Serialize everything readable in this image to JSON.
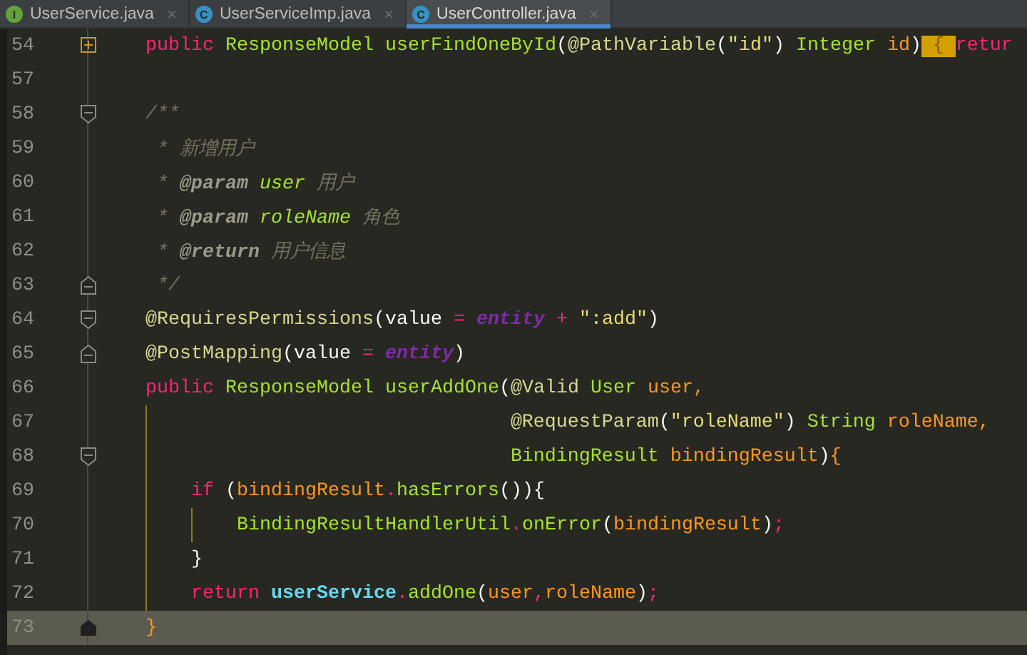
{
  "tabs": [
    {
      "icon": {
        "letter": "I",
        "color": "#62a33a"
      },
      "label": "UserService.java",
      "close": "×",
      "selected": false
    },
    {
      "icon": {
        "letter": "C",
        "color": "#3592c4"
      },
      "label": "UserServiceImp.java",
      "close": "×",
      "selected": false
    },
    {
      "icon": {
        "letter": "C",
        "color": "#3592c4"
      },
      "label": "UserController.java",
      "close": "×",
      "selected": true
    }
  ],
  "editor": {
    "lines": [
      {
        "number": "54",
        "fold": {
          "kind": "collapsed"
        },
        "kind": "top",
        "current": false,
        "tokens": [
          {
            "text": "public ",
            "kind": "keyword"
          },
          {
            "text": "ResponseModel ",
            "kind": "type"
          },
          {
            "text": "userFindOneById",
            "kind": "type"
          },
          {
            "text": "(",
            "kind": "plain"
          },
          {
            "text": "@PathVariable",
            "kind": "annotation"
          },
          {
            "text": "(",
            "kind": "plain"
          },
          {
            "text": "\"id\"",
            "kind": "string"
          },
          {
            "text": ") ",
            "kind": "plain"
          },
          {
            "text": "Integer ",
            "kind": "type"
          },
          {
            "text": "id",
            "kind": "param"
          },
          {
            "text": ")",
            "kind": "plain"
          },
          {
            "text": "{",
            "kind": "fold-box"
          },
          {
            "text": "retur",
            "kind": "keyword"
          }
        ]
      },
      {
        "number": "57",
        "kind": "top",
        "current": false
      },
      {
        "number": "58",
        "fold": {
          "kind": "start"
        },
        "kind": "top",
        "current": false,
        "tokens": [
          {
            "text": "/**",
            "kind": "comment"
          }
        ]
      },
      {
        "number": "59",
        "kind": "doc",
        "current": false,
        "tokens": [
          {
            "text": "* 新增用户",
            "kind": "comment"
          }
        ]
      },
      {
        "number": "60",
        "kind": "doc",
        "current": false,
        "tokens": [
          {
            "text": "* ",
            "kind": "comment"
          },
          {
            "text": "@param ",
            "kind": "doctag"
          },
          {
            "text": "user",
            "kind": "docparam"
          },
          {
            "text": " 用户",
            "kind": "comment"
          }
        ]
      },
      {
        "number": "61",
        "kind": "doc",
        "current": false,
        "tokens": [
          {
            "text": "* ",
            "kind": "comment"
          },
          {
            "text": "@param ",
            "kind": "doctag"
          },
          {
            "text": "roleName",
            "kind": "docparam"
          },
          {
            "text": " 角色",
            "kind": "comment"
          }
        ]
      },
      {
        "number": "62",
        "kind": "doc",
        "current": false,
        "tokens": [
          {
            "text": "* ",
            "kind": "comment"
          },
          {
            "text": "@return",
            "kind": "doctag"
          },
          {
            "text": " 用户信息",
            "kind": "comment"
          }
        ]
      },
      {
        "number": "63",
        "fold": {
          "kind": "end"
        },
        "kind": "doc",
        "current": false,
        "tokens": [
          {
            "text": "*/",
            "kind": "comment"
          }
        ]
      },
      {
        "number": "64",
        "fold": {
          "kind": "start"
        },
        "kind": "top",
        "current": false,
        "tokens": [
          {
            "text": "@RequiresPermissions",
            "kind": "annotation"
          },
          {
            "text": "(value ",
            "kind": "plain"
          },
          {
            "text": "= ",
            "kind": "operator"
          },
          {
            "text": "entity ",
            "kind": "constant"
          },
          {
            "text": "+ ",
            "kind": "operator"
          },
          {
            "text": "\":add\"",
            "kind": "string"
          },
          {
            "text": ")",
            "kind": "plain"
          }
        ]
      },
      {
        "number": "65",
        "fold": {
          "kind": "end"
        },
        "kind": "top",
        "current": false,
        "tokens": [
          {
            "text": "@PostMapping",
            "kind": "annotation"
          },
          {
            "text": "(value ",
            "kind": "plain"
          },
          {
            "text": "= ",
            "kind": "operator"
          },
          {
            "text": "entity",
            "kind": "constant"
          },
          {
            "text": ")",
            "kind": "plain"
          }
        ]
      },
      {
        "number": "66",
        "kind": "top",
        "current": false,
        "tokens": [
          {
            "text": "public ",
            "kind": "keyword"
          },
          {
            "text": "ResponseModel ",
            "kind": "type"
          },
          {
            "text": "userAddOne",
            "kind": "type"
          },
          {
            "text": "(",
            "kind": "plain"
          },
          {
            "text": "@Valid ",
            "kind": "annotation"
          },
          {
            "text": "User ",
            "kind": "type"
          },
          {
            "text": "user,",
            "kind": "param"
          }
        ]
      },
      {
        "number": "67",
        "kind": "continuation",
        "current": false,
        "tokens": [
          {
            "text": "@RequestParam",
            "kind": "annotation"
          },
          {
            "text": "(",
            "kind": "plain"
          },
          {
            "text": "\"roleName\"",
            "kind": "string"
          },
          {
            "text": ") ",
            "kind": "plain"
          },
          {
            "text": "String ",
            "kind": "type"
          },
          {
            "text": "roleName,",
            "kind": "param"
          }
        ]
      },
      {
        "number": "68",
        "fold": {
          "kind": "start"
        },
        "kind": "continuation",
        "current": false,
        "tokens": [
          {
            "text": "BindingResult ",
            "kind": "type"
          },
          {
            "text": "bindingResult",
            "kind": "param"
          },
          {
            "text": ")",
            "kind": "plain"
          },
          {
            "text": "{",
            "kind": "param"
          }
        ]
      },
      {
        "number": "69",
        "kind": "block",
        "current": false,
        "tokens": [
          {
            "text": "if ",
            "kind": "keyword"
          },
          {
            "text": "(",
            "kind": "plain"
          },
          {
            "text": "bindingResult",
            "kind": "param"
          },
          {
            "text": ".",
            "kind": "operator"
          },
          {
            "text": "hasErrors",
            "kind": "type"
          },
          {
            "text": "()){",
            "kind": "plain"
          }
        ]
      },
      {
        "number": "70",
        "kind": "nested",
        "current": false,
        "tokens": [
          {
            "text": "BindingResultHandlerUtil",
            "kind": "type"
          },
          {
            "text": ".",
            "kind": "operator"
          },
          {
            "text": "onError",
            "kind": "type"
          },
          {
            "text": "(",
            "kind": "plain"
          },
          {
            "text": "bindingResult",
            "kind": "param"
          },
          {
            "text": ")",
            "kind": "plain"
          },
          {
            "text": ";",
            "kind": "operator"
          }
        ]
      },
      {
        "number": "71",
        "kind": "block",
        "current": false,
        "tokens": [
          {
            "text": "}",
            "kind": "plain"
          }
        ]
      },
      {
        "number": "72",
        "kind": "block",
        "current": false,
        "tokens": [
          {
            "text": "return ",
            "kind": "keyword"
          },
          {
            "text": "userService",
            "kind": "field"
          },
          {
            "text": ".",
            "kind": "operator"
          },
          {
            "text": "addOne",
            "kind": "type"
          },
          {
            "text": "(",
            "kind": "plain"
          },
          {
            "text": "user",
            "kind": "param"
          },
          {
            "text": ",",
            "kind": "operator"
          },
          {
            "text": "roleName",
            "kind": "param"
          },
          {
            "text": ")",
            "kind": "plain"
          },
          {
            "text": ";",
            "kind": "operator"
          }
        ]
      },
      {
        "number": "73",
        "fold": {
          "kind": "end"
        },
        "kind": "top",
        "current": true,
        "tokens": [
          {
            "text": "}",
            "kind": "param"
          }
        ]
      }
    ]
  }
}
